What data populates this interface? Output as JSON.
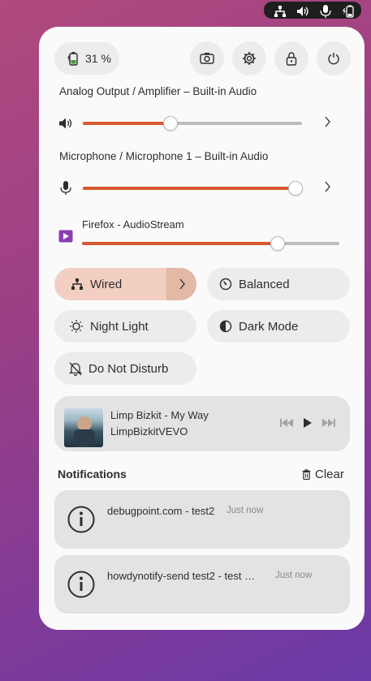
{
  "battery": {
    "percent_label": "31 %"
  },
  "audio": {
    "output_label": "Analog Output / Amplifier – Built-in Audio",
    "output_level": 0.4,
    "input_label": "Microphone / Microphone 1 – Built-in Audio",
    "input_level": 0.97,
    "app_label": "Firefox - AudioStream",
    "app_level": 0.76
  },
  "quick_settings": {
    "wired": "Wired",
    "balanced": "Balanced",
    "night_light": "Night Light",
    "dark_mode": "Dark Mode",
    "do_not_disturb": "Do Not Disturb"
  },
  "media": {
    "title": "Limp Bizkit - My Way",
    "artist": "LimpBizkitVEVO"
  },
  "notifications": {
    "header": "Notifications",
    "clear_label": "Clear",
    "items": [
      {
        "text": "debugpoint.com - test2",
        "time": "Just now"
      },
      {
        "text": "howdynotify-send test2 - test …",
        "time": "Just now"
      }
    ]
  },
  "colors": {
    "accent": "#d6592f",
    "wired_active_bg": "#f2cfc0",
    "panel_bg": "#fafafa",
    "button_bg": "#ececec"
  }
}
